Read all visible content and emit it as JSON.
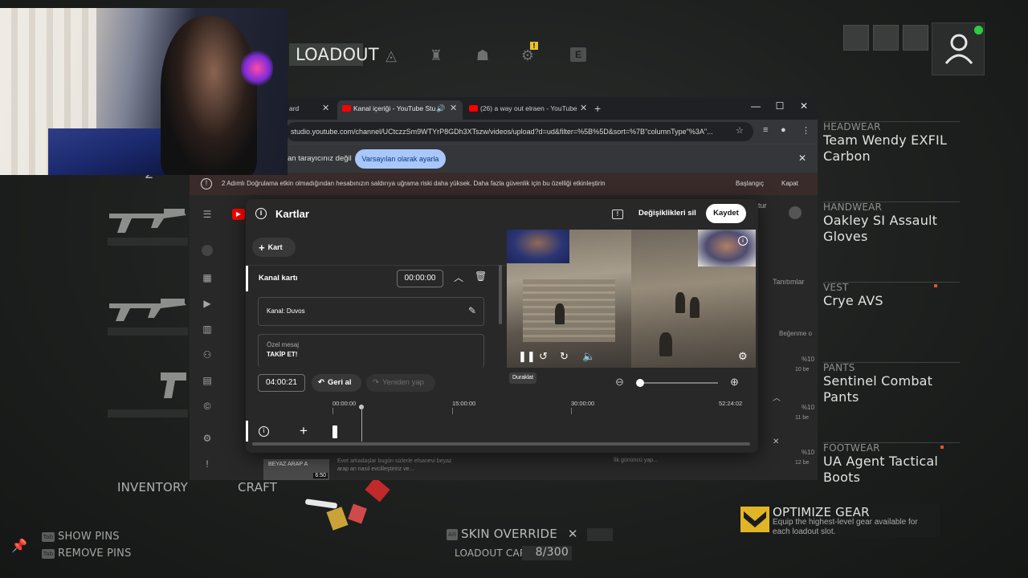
{
  "game": {
    "tab_loadout": "LOADOUT",
    "tab_e_key": "E",
    "warn_badge": "!",
    "gear": [
      {
        "category": "HEADWEAR",
        "name": "Team Wendy EXFIL Carbon"
      },
      {
        "category": "HANDWEAR",
        "name": "Oakley SI Assault Gloves"
      },
      {
        "category": "VEST",
        "name": "Crye AVS"
      },
      {
        "category": "PANTS",
        "name": "Sentinel Combat Pants"
      },
      {
        "category": "FOOTWEAR",
        "name": "UA Agent Tactical Boots"
      }
    ],
    "inventory": "INVENTORY",
    "craft": "CRAFT",
    "show_pins": "SHOW PINS",
    "remove_pins": "REMOVE PINS",
    "pin_key": "Tab",
    "skin_override": "SKIN OVERRIDE",
    "alt_key": "Alt",
    "loadout_capacity_label": "LOADOUT CAPACITY",
    "loadout_capacity_value": "8/300",
    "optimize_title": "OPTIMIZE GEAR",
    "optimize_desc": "Equip the highest-level gear available for each loadout slot.",
    "left_partial": "2",
    "accent_yellow": "#e1b526",
    "status_green": "#2ecc40"
  },
  "browser": {
    "tabs": [
      {
        "title": "ard"
      },
      {
        "title": "Kanal içeriği - YouTube Stu"
      },
      {
        "title": "(26) a way out elraen - YouTube"
      }
    ],
    "new_tab": "+",
    "address": "studio.youtube.com/channel/UCtczzSm9WTYrP8GDh3XTszw/videos/upload?d=ud&filter=%5B%5D&sort=%7B\"columnType\"%3A\"...",
    "infobar_text": "an tarayıcınız değil",
    "infobar_button": "Varsayılan olarak ayarla",
    "warning_text": "2 Adımlı Doğrulama etkin olmadığından hesabınızın saldırıya uğrama riski daha yüksek. Daha fazla güvenlik için bu özelliği etkinleştirin",
    "warning_start": "Başlangıç",
    "warning_close": "Kapat",
    "studio_right": {
      "tur": "tur",
      "tanitimlar": "Tanıtımlar",
      "begenme": "Beğenme o",
      "pct1": "%10",
      "sub1": "10 be",
      "pct2": "%10",
      "sub2": "11 be",
      "pct3": "%10",
      "sub3": "12 be"
    },
    "video_row": {
      "thumb_text": "BEYAZ ARAP A",
      "duration": "6:50",
      "desc": "Evet arkadaşlar bugün sizlerle efsanevi beyaz arap an nasıl evcilleştiririz ve...",
      "visibility": "İlk gününcü yap..."
    }
  },
  "cards_dialog": {
    "title": "Kartlar",
    "discard": "Değişiklikleri sil",
    "save": "Kaydet",
    "add_card": "Kart",
    "card_name": "Kanal kartı",
    "card_time": "00:00:00",
    "channel_label": "Kanal: Duvos",
    "message_label": "Özel mesaj",
    "message_value": "TAKİP ET!",
    "current_time": "04:00:21",
    "undo": "Geri al",
    "redo": "Yeniden yap",
    "tooltip": "Duraklat",
    "ruler": [
      "00:00:00",
      "15:00:00",
      "30:00:00",
      "52:24:02"
    ]
  },
  "icons": [
    "shield-icon",
    "settings-icon",
    "profile-icon",
    "menu-icon",
    "youtube-icon",
    "info-icon",
    "feedback-icon",
    "pencil-icon",
    "trash-icon",
    "chevron-up-icon",
    "undo-icon",
    "redo-icon",
    "zoom-out-icon",
    "zoom-in-icon",
    "play-icon",
    "rewind-10-icon",
    "forward-10-icon",
    "volume-icon",
    "close-icon"
  ]
}
